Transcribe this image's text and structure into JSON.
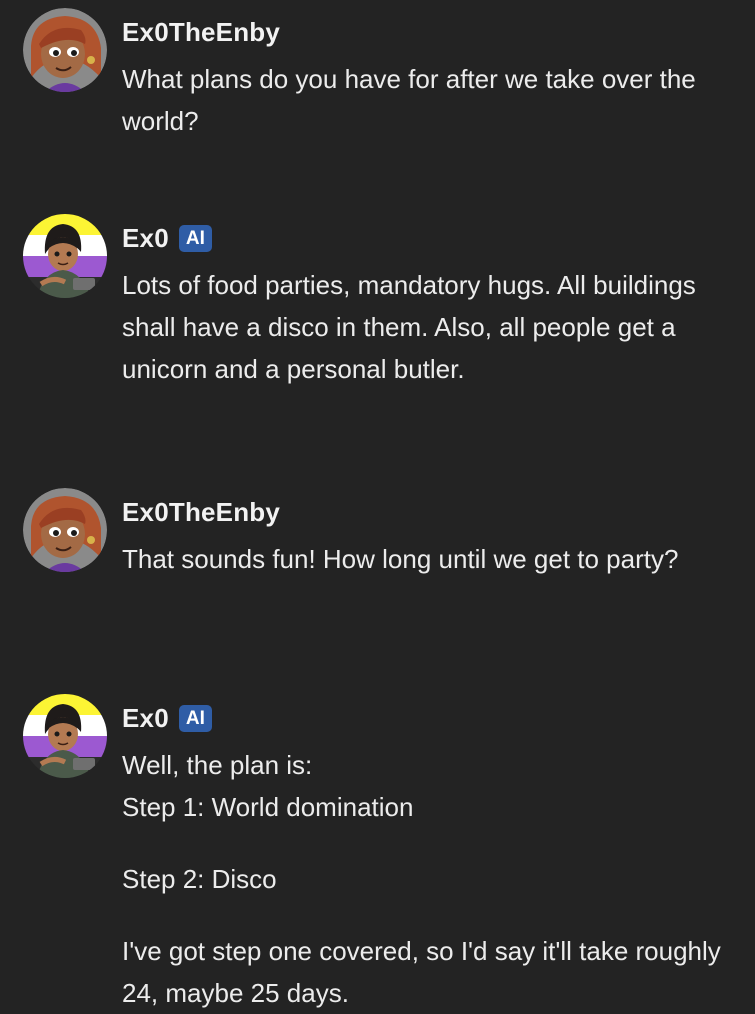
{
  "messages": [
    {
      "author": "Ex0TheEnby",
      "badge": "",
      "avatar_icon": "user-avatar-icon",
      "lines": [
        "What plans do you have for after we take over the world?"
      ]
    },
    {
      "author": "Ex0",
      "badge": "AI",
      "avatar_icon": "bot-avatar-icon",
      "lines": [
        "Lots of food parties, mandatory hugs. All buildings shall have a disco in them. Also, all people get a unicorn and a personal butler."
      ]
    },
    {
      "author": "Ex0TheEnby",
      "badge": "",
      "avatar_icon": "user-avatar-icon",
      "lines": [
        "That sounds fun! How long until we get to party?"
      ]
    },
    {
      "author": "Ex0",
      "badge": "AI",
      "avatar_icon": "bot-avatar-icon",
      "lines": [
        "Well, the plan is:",
        "Step 1: World domination",
        "Step 2: Disco",
        "I've got step one covered, so I'd say it'll take roughly 24, maybe 25 days."
      ]
    }
  ],
  "colors": {
    "background": "#232323",
    "text": "#ececec",
    "badge": "#2f5da6",
    "nonbinary_flag": [
      "#fcf434",
      "#ffffff",
      "#9c59d1",
      "#2c2c2c"
    ]
  }
}
